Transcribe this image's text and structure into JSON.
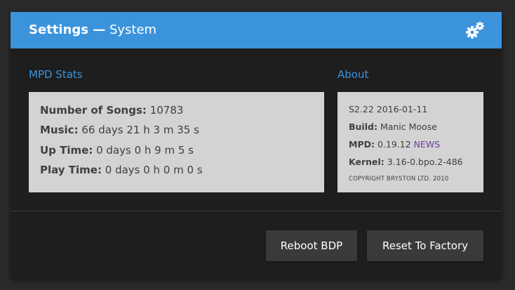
{
  "header": {
    "title_strong": "Settings —",
    "title_rest": "System",
    "icon": "gears-icon"
  },
  "mpd_stats": {
    "title": "MPD Stats",
    "items": [
      {
        "label": "Number of Songs:",
        "value": "10783"
      },
      {
        "label": "Music:",
        "value": "66 days 21 h 3 m 35 s"
      },
      {
        "label": "Up Time:",
        "value": "0 days 0 h 9 m 5 s"
      },
      {
        "label": "Play Time:",
        "value": "0 days 0 h 0 m 0 s"
      }
    ]
  },
  "about": {
    "title": "About",
    "version": "S2.22 2016-01-11",
    "build_label": "Build:",
    "build_value": "Manic Moose",
    "mpd_label": "MPD:",
    "mpd_value": "0.19.12",
    "news_link": "NEWS",
    "kernel_label": "Kernel:",
    "kernel_value": "3.16-0.bpo.2-486",
    "copyright": "COPYRIGHT BRYSTON LTD. 2010"
  },
  "actions": {
    "reboot_label": "Reboot BDP",
    "reset_label": "Reset To Factory"
  },
  "colors": {
    "accent": "#3b93dc",
    "panel": "#1e1e1e",
    "box": "#d3d3d3",
    "button": "#3a3a3a",
    "link": "#6a3fa0"
  }
}
